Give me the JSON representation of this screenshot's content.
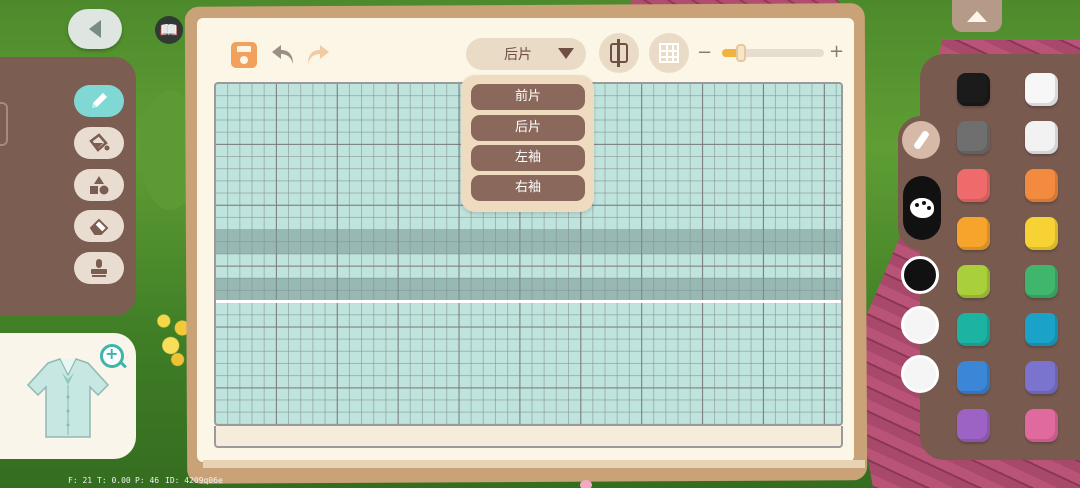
{
  "toolbar": {
    "piece_selected": "后片",
    "zoom_min_label": "−",
    "zoom_max_label": "+",
    "zoom_level": 0.18
  },
  "dropdown": {
    "options": [
      "前片",
      "后片",
      "左袖",
      "右袖"
    ]
  },
  "tools": [
    {
      "name": "pencil-tool",
      "icon": "pencil-icon",
      "active": true
    },
    {
      "name": "fill-tool",
      "icon": "paint-bucket-icon",
      "active": false
    },
    {
      "name": "shapes-tool",
      "icon": "shapes-icon",
      "active": false
    },
    {
      "name": "eraser-tool",
      "icon": "eraser-icon",
      "active": false
    },
    {
      "name": "stamp-tool",
      "icon": "stamp-icon",
      "active": false
    }
  ],
  "palette": {
    "swatches": [
      "#1b1b1b",
      "#f7f7f7",
      "#6f6f6f",
      "#f2f2f2",
      "#ef6b6b",
      "#f28a3f",
      "#f6a42c",
      "#f6d235",
      "#a9cf3a",
      "#3fb66b",
      "#1cb3a3",
      "#1aa2c9",
      "#3b86d6",
      "#7b74cf",
      "#9c62c4",
      "#e06a9e"
    ],
    "current_colors": [
      "#111111",
      "#f5f5f5",
      "#f5f5f5"
    ]
  },
  "debug": {
    "fps": "F: 21",
    "time": "T: 0.00",
    "ping": "P: 46",
    "id": "ID: 4209q06e"
  }
}
